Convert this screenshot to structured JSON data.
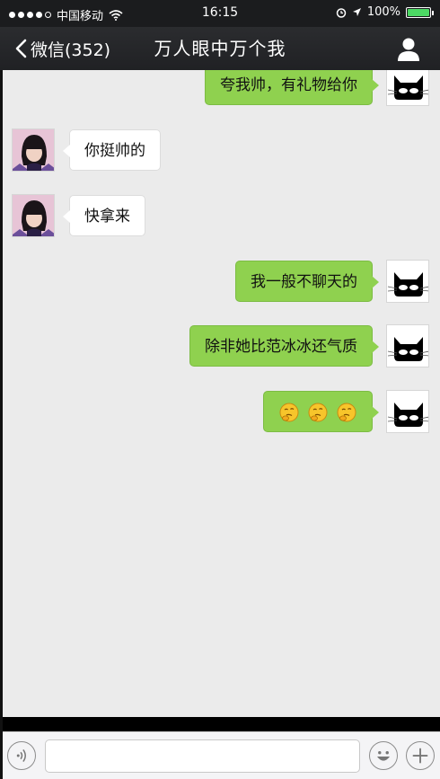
{
  "status_bar": {
    "carrier": "中国移动",
    "time": "16:15",
    "battery": "100%",
    "battery_level": 1.0
  },
  "nav": {
    "back_label": "微信(352)",
    "title": "万人眼中万个我"
  },
  "messages": [
    {
      "side": "right",
      "kind": "text",
      "text": "夸我帅，有礼物给你"
    },
    {
      "side": "left",
      "kind": "text",
      "text": "你挺帅的"
    },
    {
      "side": "left",
      "kind": "text",
      "text": "快拿来"
    },
    {
      "side": "right",
      "kind": "text",
      "text": "我一般不聊天的"
    },
    {
      "side": "right",
      "kind": "text",
      "text": "除非她比范冰冰还气质"
    },
    {
      "side": "right",
      "kind": "emoji",
      "emoji": [
        "thinking-face-icon",
        "thinking-face-icon",
        "thinking-face-icon"
      ]
    }
  ],
  "input": {
    "value": "",
    "placeholder": ""
  },
  "colors": {
    "outgoing_bubble": "#8fd14f",
    "incoming_bubble": "#ffffff",
    "chat_background": "#ebebeb",
    "nav_background": "#222326"
  }
}
